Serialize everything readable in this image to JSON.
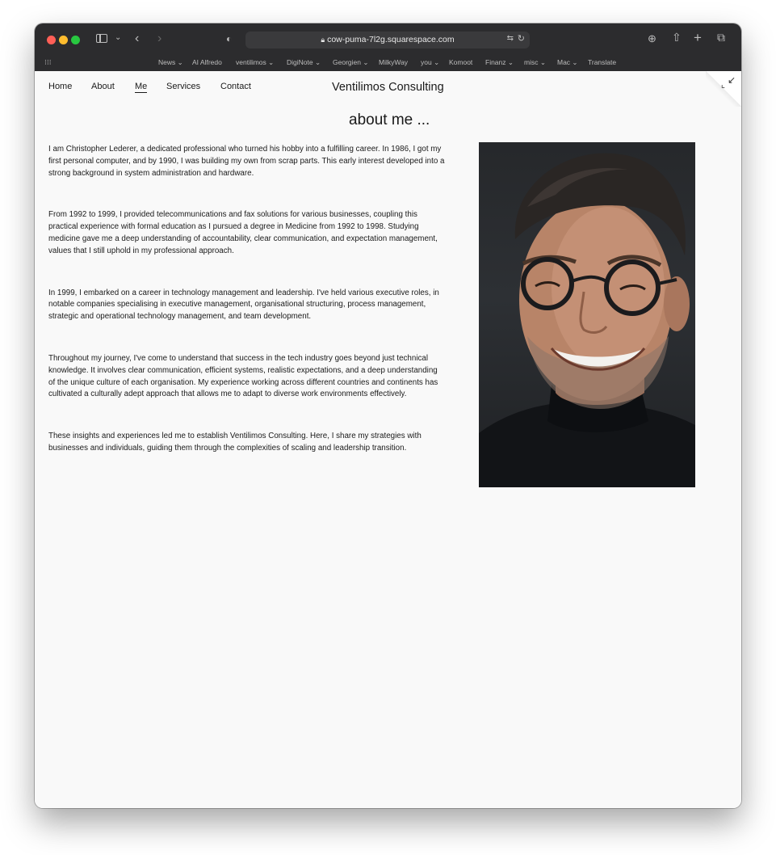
{
  "browser": {
    "url": "cow-puma-7l2g.squarespace.com",
    "bookmarks": [
      "News ⌄",
      "AI Alfredo",
      "ventilimos ⌄",
      "DigiNote ⌄",
      "Georgien ⌄",
      "MilkyWay",
      "you ⌄",
      "Komoot",
      "Finanz ⌄",
      "misc ⌄",
      "Mac ⌄",
      "Translate"
    ]
  },
  "site": {
    "title": "Ventilimos Consulting",
    "nav": [
      "Home",
      "About",
      "Me",
      "Services",
      "Contact"
    ],
    "active_nav": "Me"
  },
  "main": {
    "heading": "about me ...",
    "paragraphs": [
      "I am Christopher Lederer, a dedicated professional who turned his hobby into a fulfilling career. In 1986, I got my first personal computer, and by 1990, I was building my own from scrap parts. This early interest developed into a strong background in system administration and hardware.",
      "From 1992 to 1999, I provided telecommunications and fax solutions for various businesses, coupling this practical experience with formal education as I pursued a degree in Medicine from 1992 to 1998. Studying medicine gave me a deep understanding of accountability, clear communication, and expectation management, values that I still uphold in my professional approach.",
      "In 1999, I embarked on a career in technology management and leadership. I've held various executive roles, in notable companies specialising in executive management, organisational structuring, process management, strategic and operational technology management, and team development.",
      "Throughout my journey, I've come to understand that success in the tech industry goes beyond just technical knowledge. It involves clear communication, efficient systems, realistic expectations, and a deep understanding of the unique culture of each organisation. My experience working across different countries and continents has cultivated a culturally adept approach that allows me to adapt to diverse work environments effectively.",
      "These insights and experiences led me to establish Ventilimos Consulting. Here, I share my strategies with businesses and individuals, guiding them through the complexities of scaling and leadership transition."
    ]
  },
  "icons": {
    "toolbar": [
      "sidebar-icon",
      "chevron-down-icon",
      "back-icon",
      "forward-icon",
      "privacy-shield-icon",
      "lock-icon",
      "translate-icon",
      "reload-icon",
      "downloads-icon",
      "share-icon",
      "new-tab-icon",
      "tab-overview-icon",
      "grid-icon"
    ],
    "page": [
      "collapse-icon"
    ]
  }
}
